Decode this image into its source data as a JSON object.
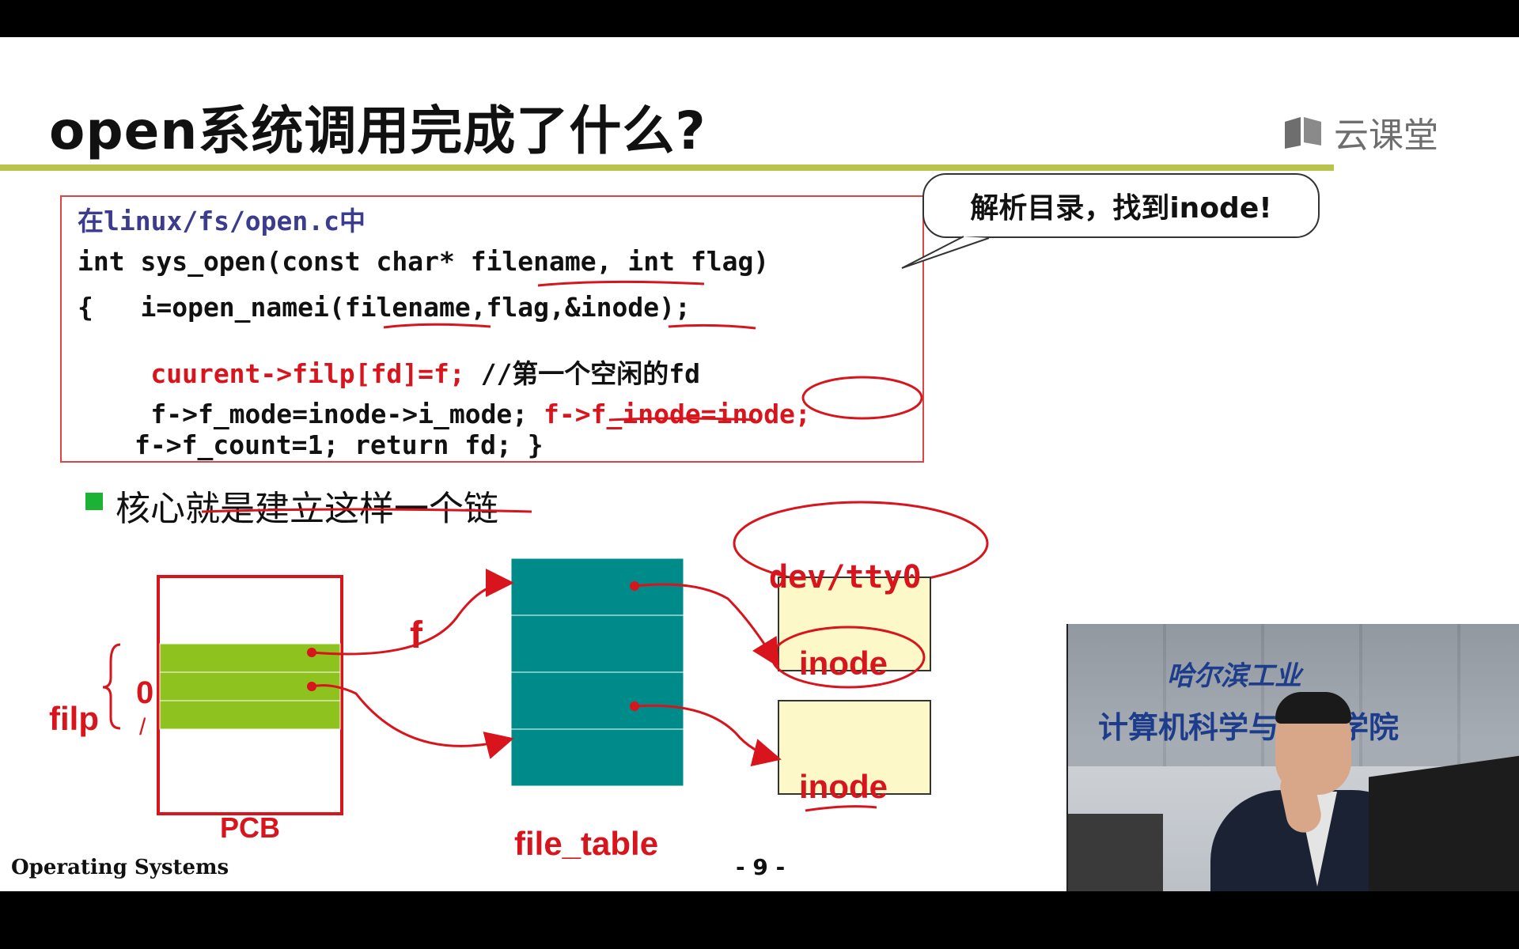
{
  "title": "open系统调用完成了什么?",
  "logo": {
    "text": "云课堂",
    "icon": "book-icon"
  },
  "code": {
    "line1": "在linux/fs/open.c中",
    "line2": "int sys_open(const char* filename, int flag)",
    "line3": "{   i=open_namei(filename,flag,&inode);",
    "line4_red": "cuurent->filp[fd]=f;",
    "line4_comment": " //第一个空闲的fd",
    "line5_black": "f->f_mode=inode->i_mode; ",
    "line5_red": "f->f_inode=inode;",
    "line6": "f->f_count=1; return fd; }"
  },
  "callout": {
    "text": "解析目录，找到inode!"
  },
  "bullet": {
    "text": "核心就是建立这样一个链"
  },
  "diagram": {
    "filp_label": "filp",
    "index0": "0",
    "index1": "/",
    "pcb_label": "PCB",
    "f_label": "f",
    "file_table_label": "file_table",
    "inode1": "inode",
    "inode2": "inode",
    "dev_label": "dev/tty0"
  },
  "footer": {
    "left": "Operating Systems",
    "page": "- 9 -"
  },
  "video": {
    "line1": "哈尔滨工业",
    "line2": "计算机科学与技术学院"
  },
  "colors": {
    "red": "#d8141c",
    "teal": "#008b8b",
    "green": "#8ec21e",
    "cream": "#fdf8c8"
  }
}
